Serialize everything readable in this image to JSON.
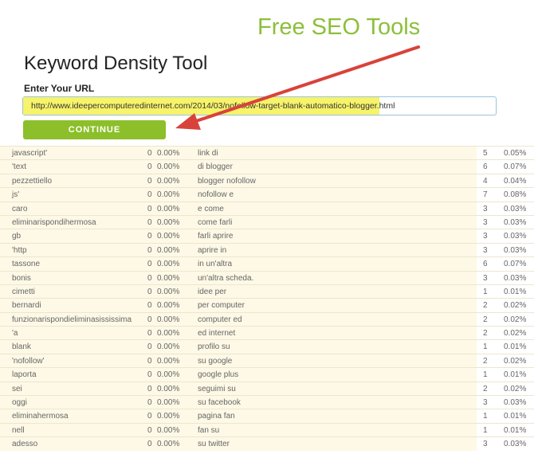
{
  "banner": "Free SEO Tools",
  "title": "Keyword Density Tool",
  "url_label": "Enter Your URL",
  "url_value": "http://www.ideepercomputeredinternet.com/2014/03/nofollow-target-blank-automatico-blogger.html",
  "continue_label": "CONTINUE",
  "colors": {
    "accent": "#8cbf2a",
    "arrow": "#d9423a",
    "highlight": "#f7f36a"
  },
  "rows": [
    [
      "javascript'",
      "0",
      "0.00%",
      "link di",
      "5",
      "0.05%"
    ],
    [
      "'text",
      "0",
      "0.00%",
      "di blogger",
      "6",
      "0.07%"
    ],
    [
      "pezzettiello",
      "0",
      "0.00%",
      "blogger nofollow",
      "4",
      "0.04%"
    ],
    [
      "js'",
      "0",
      "0.00%",
      "nofollow e",
      "7",
      "0.08%"
    ],
    [
      "caro",
      "0",
      "0.00%",
      "e come",
      "3",
      "0.03%"
    ],
    [
      "eliminarispondihermosa",
      "0",
      "0.00%",
      "come farli",
      "3",
      "0.03%"
    ],
    [
      "gb",
      "0",
      "0.00%",
      "farli aprire",
      "3",
      "0.03%"
    ],
    [
      "'http",
      "0",
      "0.00%",
      "aprire in",
      "3",
      "0.03%"
    ],
    [
      "tassone",
      "0",
      "0.00%",
      "in un'altra",
      "6",
      "0.07%"
    ],
    [
      "bonis",
      "0",
      "0.00%",
      "un'altra scheda.",
      "3",
      "0.03%"
    ],
    [
      "cimetti",
      "0",
      "0.00%",
      "idee per",
      "1",
      "0.01%"
    ],
    [
      "bernardi",
      "0",
      "0.00%",
      "per computer",
      "2",
      "0.02%"
    ],
    [
      "funzionarispondieliminasississima",
      "0",
      "0.00%",
      "computer ed",
      "2",
      "0.02%"
    ],
    [
      "'a",
      "0",
      "0.00%",
      "ed internet",
      "2",
      "0.02%"
    ],
    [
      "blank",
      "0",
      "0.00%",
      "profilo su",
      "1",
      "0.01%"
    ],
    [
      "'nofollow'",
      "0",
      "0.00%",
      "su google",
      "2",
      "0.02%"
    ],
    [
      "laporta",
      "0",
      "0.00%",
      "google plus",
      "1",
      "0.01%"
    ],
    [
      "sei",
      "0",
      "0.00%",
      "seguimi su",
      "2",
      "0.02%"
    ],
    [
      "oggi",
      "0",
      "0.00%",
      "su facebook",
      "3",
      "0.03%"
    ],
    [
      "eliminahermosa",
      "0",
      "0.00%",
      "pagina fan",
      "1",
      "0.01%"
    ],
    [
      "nell",
      "0",
      "0.00%",
      "fan su",
      "1",
      "0.01%"
    ],
    [
      "adesso",
      "0",
      "0.00%",
      "su twitter",
      "3",
      "0.03%"
    ]
  ]
}
